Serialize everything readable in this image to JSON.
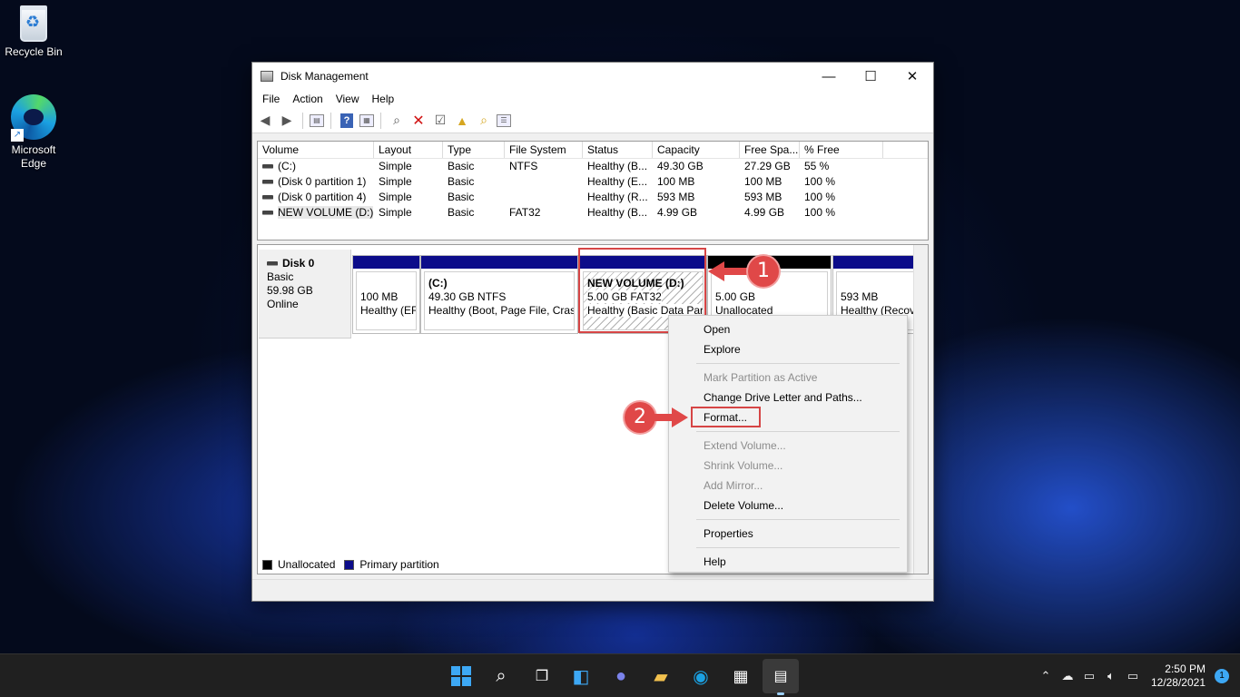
{
  "desktop": {
    "icons": [
      {
        "label": "Recycle Bin",
        "icon": "recycle-bin-icon"
      },
      {
        "label": "Microsoft Edge",
        "icon": "edge-icon"
      }
    ]
  },
  "window": {
    "title": "Disk Management",
    "controls": {
      "minimize": "—",
      "maximize": "☐",
      "close": "✕"
    },
    "menu": [
      "File",
      "Action",
      "View",
      "Help"
    ]
  },
  "volume_table": {
    "columns": [
      "Volume",
      "Layout",
      "Type",
      "File System",
      "Status",
      "Capacity",
      "Free Spa...",
      "% Free"
    ],
    "rows": [
      {
        "volume": "(C:)",
        "layout": "Simple",
        "type": "Basic",
        "fs": "NTFS",
        "status": "Healthy (B...",
        "capacity": "49.30 GB",
        "free": "27.29 GB",
        "pct": "55 %"
      },
      {
        "volume": "(Disk 0 partition 1)",
        "layout": "Simple",
        "type": "Basic",
        "fs": "",
        "status": "Healthy (E...",
        "capacity": "100 MB",
        "free": "100 MB",
        "pct": "100 %"
      },
      {
        "volume": "(Disk 0 partition 4)",
        "layout": "Simple",
        "type": "Basic",
        "fs": "",
        "status": "Healthy (R...",
        "capacity": "593 MB",
        "free": "593 MB",
        "pct": "100 %"
      },
      {
        "volume": "NEW VOLUME (D:)",
        "layout": "Simple",
        "type": "Basic",
        "fs": "FAT32",
        "status": "Healthy (B...",
        "capacity": "4.99 GB",
        "free": "4.99 GB",
        "pct": "100 %"
      }
    ]
  },
  "disk": {
    "name": "Disk 0",
    "kind": "Basic",
    "size": "59.98 GB",
    "state": "Online",
    "partitions": [
      {
        "line1": "",
        "line2": "100 MB",
        "line3": "Healthy (EF"
      },
      {
        "line1": "(C:)",
        "line2": "49.30 GB NTFS",
        "line3": "Healthy (Boot, Page File, Crash"
      },
      {
        "line1": "NEW VOLUME  (D:)",
        "line2": "5.00 GB FAT32",
        "line3": "Healthy (Basic Data Par"
      },
      {
        "line1": "",
        "line2": "5.00 GB",
        "line3": "Unallocated"
      },
      {
        "line1": "",
        "line2": "593 MB",
        "line3": "Healthy (Recover"
      }
    ]
  },
  "legend": {
    "unallocated": "Unallocated",
    "primary": "Primary partition",
    "unallocated_color": "#000000",
    "primary_color": "#0c0c8a"
  },
  "context_menu": {
    "items": [
      {
        "label": "Open",
        "enabled": true
      },
      {
        "label": "Explore",
        "enabled": true
      },
      {
        "label": "Mark Partition as Active",
        "enabled": false
      },
      {
        "label": "Change Drive Letter and Paths...",
        "enabled": true
      },
      {
        "label": "Format...",
        "enabled": true
      },
      {
        "label": "Extend Volume...",
        "enabled": false
      },
      {
        "label": "Shrink Volume...",
        "enabled": false
      },
      {
        "label": "Add Mirror...",
        "enabled": false
      },
      {
        "label": "Delete Volume...",
        "enabled": true
      },
      {
        "label": "Properties",
        "enabled": true
      },
      {
        "label": "Help",
        "enabled": true
      }
    ]
  },
  "annotations": {
    "step1": "1",
    "step2": "2",
    "color": "#e04848"
  },
  "taskbar": {
    "apps": [
      "start-icon",
      "search-icon",
      "task-view-icon",
      "widgets-icon",
      "chat-icon",
      "file-explorer-icon",
      "edge-icon",
      "store-icon",
      "disk-management-icon"
    ],
    "tray_icons": [
      "chevron-up-icon",
      "onedrive-icon",
      "network-icon",
      "volume-icon",
      "battery-icon"
    ],
    "time": "2:50 PM",
    "date": "12/28/2021",
    "notifications": "1"
  }
}
